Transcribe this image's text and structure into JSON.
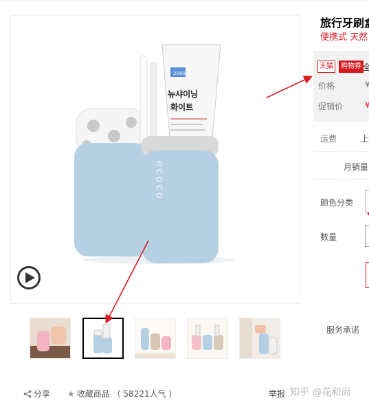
{
  "product": {
    "title": "旅行牙刷盒",
    "subtitle": "便携式 天然"
  },
  "main_image": {
    "tube_label_lines": [
      "2080",
      "뉴샤이닝",
      "화이트"
    ],
    "cup_brand": "ecoco",
    "cup_color": "#b5d0e3",
    "accent_color": "#d71a1e"
  },
  "price_box": {
    "badge_tmall": "天猫",
    "badge_coupon": "购物券",
    "badge_more": "全",
    "price_label": "价格",
    "price_value": "¥",
    "promo_label": "促销价",
    "promo_value": "¥"
  },
  "shipping": {
    "label": "运费",
    "value": "上"
  },
  "sales": {
    "label": "月销量"
  },
  "options": {
    "color_label": "颜色分类",
    "quantity_label": "数量"
  },
  "service": {
    "label": "服务承诺"
  },
  "bottom_bar": {
    "share": "分享",
    "favorite": "收藏商品",
    "popularity": "（ 58221人气 ）",
    "report": "举报"
  },
  "watermark": "知乎 @花和尚"
}
